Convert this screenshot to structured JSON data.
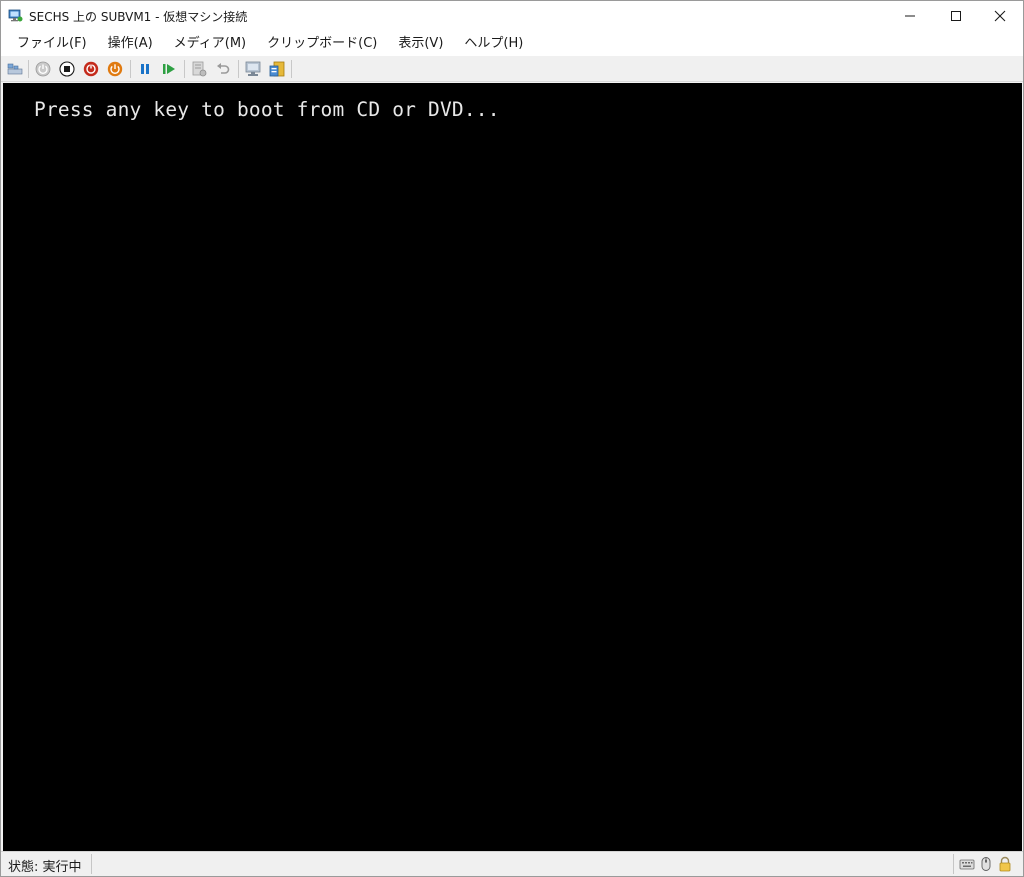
{
  "window": {
    "title": "SECHS 上の SUBVM1 - 仮想マシン接続"
  },
  "menubar": {
    "items": [
      "ファイル(F)",
      "操作(A)",
      "メディア(M)",
      "クリップボード(C)",
      "表示(V)",
      "ヘルプ(H)"
    ]
  },
  "toolbar": {
    "icons": [
      "ctrl-alt-del-icon",
      "start-icon",
      "turn-off-icon",
      "shut-down-icon",
      "save-icon",
      "pause-icon",
      "resume-icon",
      "checkpoint-icon",
      "revert-icon",
      "enhanced-session-icon",
      "share-icon"
    ]
  },
  "screen": {
    "console_text": "Press any key to boot from CD or DVD..."
  },
  "statusbar": {
    "status": "状態: 実行中",
    "icons": [
      "keyboard-icon",
      "mouse-icon",
      "lock-icon"
    ]
  },
  "colors": {
    "screen_bg": "#000000",
    "console_fg": "#e8e8e8",
    "stop_red": "#c42b1c",
    "power_orange": "#e07a10",
    "pause_blue": "#1a73c8",
    "resume_green": "#2ea043"
  }
}
